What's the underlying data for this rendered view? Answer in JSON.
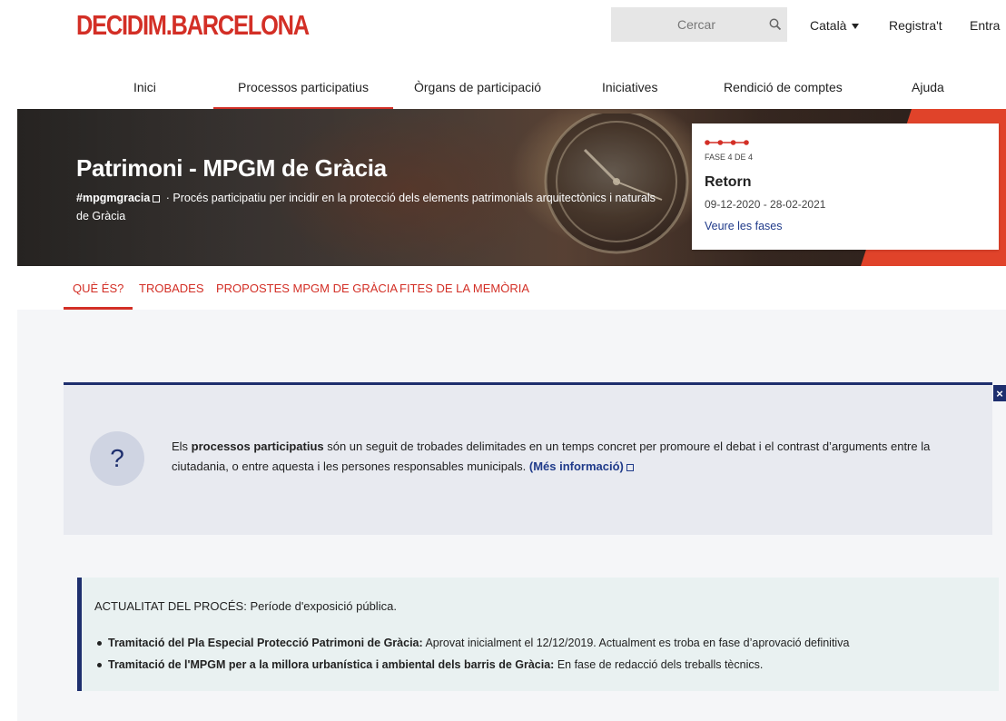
{
  "header": {
    "logo": "DECIDIM.BARCELONA",
    "search_placeholder": "Cercar",
    "language": "Català",
    "register": "Registra't",
    "login": "Entra"
  },
  "main_nav": [
    {
      "label": "Inici",
      "active": false
    },
    {
      "label": "Processos participatius",
      "active": true
    },
    {
      "label": "Òrgans de participació",
      "active": false
    },
    {
      "label": "Iniciatives",
      "active": false
    },
    {
      "label": "Rendició de comptes",
      "active": false
    },
    {
      "label": "Ajuda",
      "active": false
    }
  ],
  "hero": {
    "title": "Patrimoni - MPGM de Gràcia",
    "hashtag": "#mpgmgracia",
    "separator": "·",
    "description": "Procés participatiu per incidir en la protecció dels elements patrimonials arquitectònics i naturals de Gràcia"
  },
  "phase": {
    "label": "FASE 4 DE 4",
    "name": "Retorn",
    "dates": "09-12-2020 - 28-02-2021",
    "link": "Veure les fases",
    "current": 4,
    "total": 4,
    "color": "#d32f26"
  },
  "sub_tabs": [
    {
      "label": "Què és?",
      "active": true
    },
    {
      "label": "Trobades",
      "active": false
    },
    {
      "label": "Propostes MPGM de Gràcia",
      "active": false
    },
    {
      "label": "Fites de la memòria",
      "active": false
    }
  ],
  "info": {
    "icon": "?",
    "close": "×",
    "text_before": "Els ",
    "text_bold": "processos participatius",
    "text_after": " són un seguit de trobades delimitades en un temps concret per promoure el debat i el contrast d’arguments entre la ciutadania, o entre aquesta i les persones responsables municipals. ",
    "link": "(Més informació)"
  },
  "news": {
    "head_bold": "ACTUALITAT DEL PROCÉS:",
    "head_text": " Període d'exposició pública.",
    "items": [
      {
        "bold": "Tramitació del Pla Especial Protecció Patrimoni de Gràcia:",
        "text": " Aprovat inicialment el 12/12/2019. Actualment es troba en fase d’aprovació definitiva"
      },
      {
        "bold": "Tramitació de l'MPGM per a la millora urbanística i ambiental dels barris de Gràcia:",
        "text": " En fase de redacció dels treballs tècnics."
      }
    ]
  },
  "colors": {
    "brand_red": "#d32f26",
    "navy": "#1e2f6e",
    "link_blue": "#203b8a"
  }
}
